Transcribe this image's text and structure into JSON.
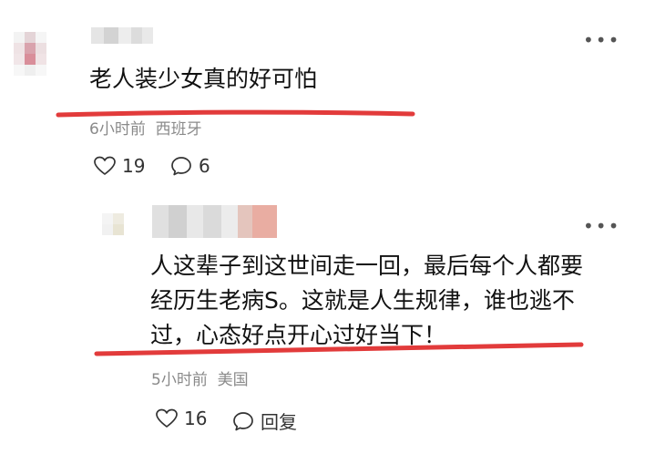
{
  "comment1": {
    "text": "老人装少女真的好可怕",
    "meta_time": "6小时前",
    "meta_location": "西班牙",
    "like_count": "19",
    "reply_count": "6"
  },
  "comment2": {
    "text_line1": "人这辈子到这世间走一回，最后每个人都要",
    "text_line2": "经历生老病S。这就是人生规律，谁也逃不",
    "text_line3": "过，心态好点开心过好当下！",
    "meta_time": "5小时前",
    "meta_location": "美国",
    "like_count": "16",
    "reply_label": "回复"
  },
  "icons": {
    "more": "more-icon",
    "like": "heart-icon",
    "reply": "speech-bubble-icon"
  },
  "colors": {
    "highlight_underline": "#e23b3b",
    "meta_text": "#8a8a8a"
  }
}
